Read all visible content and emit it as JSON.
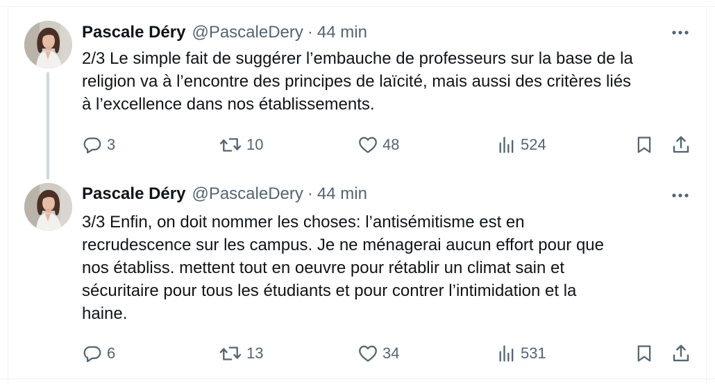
{
  "tweets": [
    {
      "author_name": "Pascale Déry",
      "handle": "@PascaleDery",
      "separator": "·",
      "time": "44 min",
      "lines": [
        "2/3 Le simple fait de suggérer l’embauche de professeurs sur la base de la",
        "religion va à l’encontre des principes de laïcité, mais aussi des critères liés",
        "à l’excellence dans nos établissements."
      ],
      "replies": "3",
      "retweets": "10",
      "likes": "48",
      "views": "524"
    },
    {
      "author_name": "Pascale Déry",
      "handle": "@PascaleDery",
      "separator": "·",
      "time": "44 min",
      "lines": [
        "3/3 Enfin, on doit nommer les choses: l’antisémitisme est en",
        "recrudescence sur les campus. Je ne ménagerai aucun effort pour que",
        "nos établiss. mettent tout en oeuvre pour rétablir un climat sain et",
        "sécuritaire pour tous les étudiants et pour contrer l’intimidation et la",
        "haine."
      ],
      "replies": "6",
      "retweets": "13",
      "likes": "34",
      "views": "531"
    }
  ],
  "icons": {
    "reply": "reply-icon",
    "retweet": "retweet-icon",
    "like": "heart-icon",
    "views": "views-icon",
    "bookmark": "bookmark-icon",
    "share": "share-icon",
    "more": "more-icon"
  },
  "colors": {
    "text": "#0f1419",
    "secondary": "#536471",
    "thread_line": "#cfd9de",
    "border": "#eff3f4"
  }
}
